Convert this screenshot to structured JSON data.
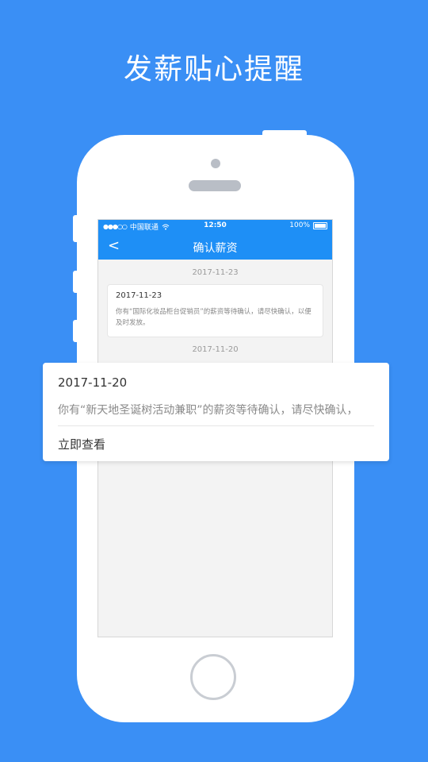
{
  "headline": "发薪贴心提醒",
  "status_bar": {
    "signal": "●●●○○",
    "carrier": "中国联通",
    "wifi_icon": "wifi-icon",
    "time": "12:50",
    "battery": "100%"
  },
  "nav": {
    "back_icon": "<",
    "title": "确认薪资"
  },
  "messages": [
    {
      "divider_date": "2017-11-23",
      "date": "2017-11-23",
      "text": "你有“国际化妆品柜台促销员”的薪资等待确认，请尽快确认，以便及时发放。"
    }
  ],
  "divider_date_2": "2017-11-20",
  "popup": {
    "date": "2017-11-20",
    "text": "你有“新天地圣诞树活动兼职”的薪资等待确认，请尽快确认，",
    "action": "立即查看"
  },
  "colors": {
    "background": "#3a8ff5",
    "accent": "#1e8ff6"
  }
}
